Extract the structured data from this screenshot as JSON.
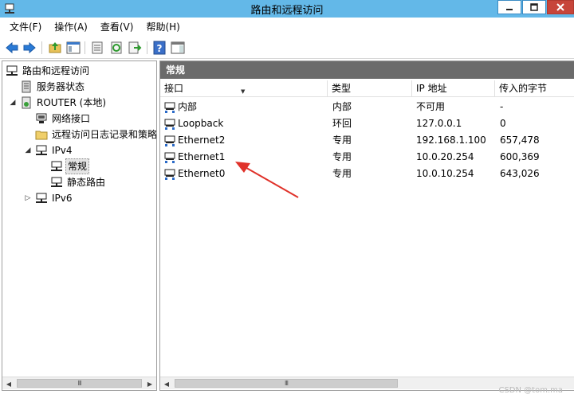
{
  "window": {
    "title": "路由和远程访问"
  },
  "menubar": {
    "items": [
      "文件(F)",
      "操作(A)",
      "查看(V)",
      "帮助(H)"
    ]
  },
  "toolbar": {
    "buttons": [
      "back-arrow-icon",
      "forward-arrow-icon",
      "up-folder-icon",
      "console-tree-icon",
      "properties-icon",
      "refresh-icon",
      "export-icon",
      "help-icon",
      "show-hide-icon"
    ]
  },
  "tree": {
    "items": [
      {
        "label": "路由和远程访问",
        "icon": "routing-icon"
      },
      {
        "label": "服务器状态",
        "icon": "server-status-icon"
      },
      {
        "label": "ROUTER (本地)",
        "icon": "server-icon"
      },
      {
        "label": "网络接口",
        "icon": "network-interface-icon"
      },
      {
        "label": "远程访问日志记录和策略",
        "icon": "folder-icon"
      },
      {
        "label": "IPv4",
        "icon": "protocol-icon"
      },
      {
        "label": "常规",
        "icon": "general-icon"
      },
      {
        "label": "静态路由",
        "icon": "static-route-icon"
      },
      {
        "label": "IPv6",
        "icon": "protocol-icon"
      }
    ]
  },
  "list": {
    "header": "常规",
    "columns": [
      "接口",
      "类型",
      "IP 地址",
      "传入的字节"
    ],
    "rows": [
      {
        "name": "内部",
        "type": "内部",
        "ip": "不可用",
        "bytes": "-"
      },
      {
        "name": "Loopback",
        "type": "环回",
        "ip": "127.0.0.1",
        "bytes": "0"
      },
      {
        "name": "Ethernet2",
        "type": "专用",
        "ip": "192.168.1.100",
        "bytes": "657,478"
      },
      {
        "name": "Ethernet1",
        "type": "专用",
        "ip": "10.0.20.254",
        "bytes": "600,369"
      },
      {
        "name": "Ethernet0",
        "type": "专用",
        "ip": "10.0.10.254",
        "bytes": "643,026"
      }
    ]
  },
  "scrollbar": {
    "thumb_grip": "III"
  },
  "watermark": "CSDN @tom.ma",
  "colors": {
    "titlebar": "#63b8e8",
    "pane_header": "#6b6b6b",
    "annotation_arrow": "#e0322a"
  }
}
